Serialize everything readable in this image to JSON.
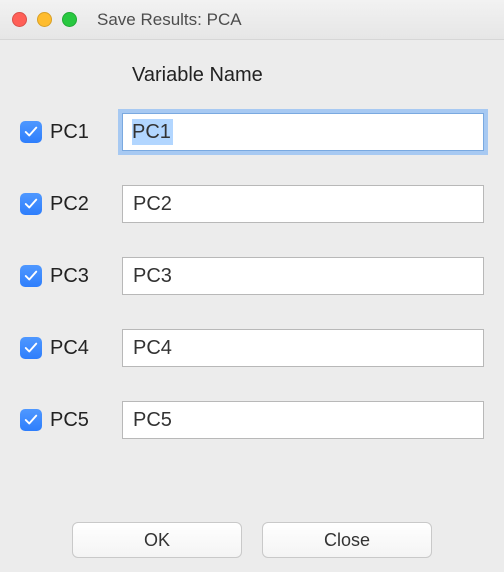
{
  "window": {
    "title": "Save Results: PCA"
  },
  "header": "Variable Name",
  "rows": [
    {
      "checked": true,
      "label": "PC1",
      "value": "PC1",
      "focused": true
    },
    {
      "checked": true,
      "label": "PC2",
      "value": "PC2",
      "focused": false
    },
    {
      "checked": true,
      "label": "PC3",
      "value": "PC3",
      "focused": false
    },
    {
      "checked": true,
      "label": "PC4",
      "value": "PC4",
      "focused": false
    },
    {
      "checked": true,
      "label": "PC5",
      "value": "PC5",
      "focused": false
    }
  ],
  "buttons": {
    "ok": "OK",
    "close": "Close"
  },
  "colors": {
    "checkbox": "#2e7efc",
    "focusRing": "#a7c9f2",
    "selection": "#b2d6ff"
  }
}
